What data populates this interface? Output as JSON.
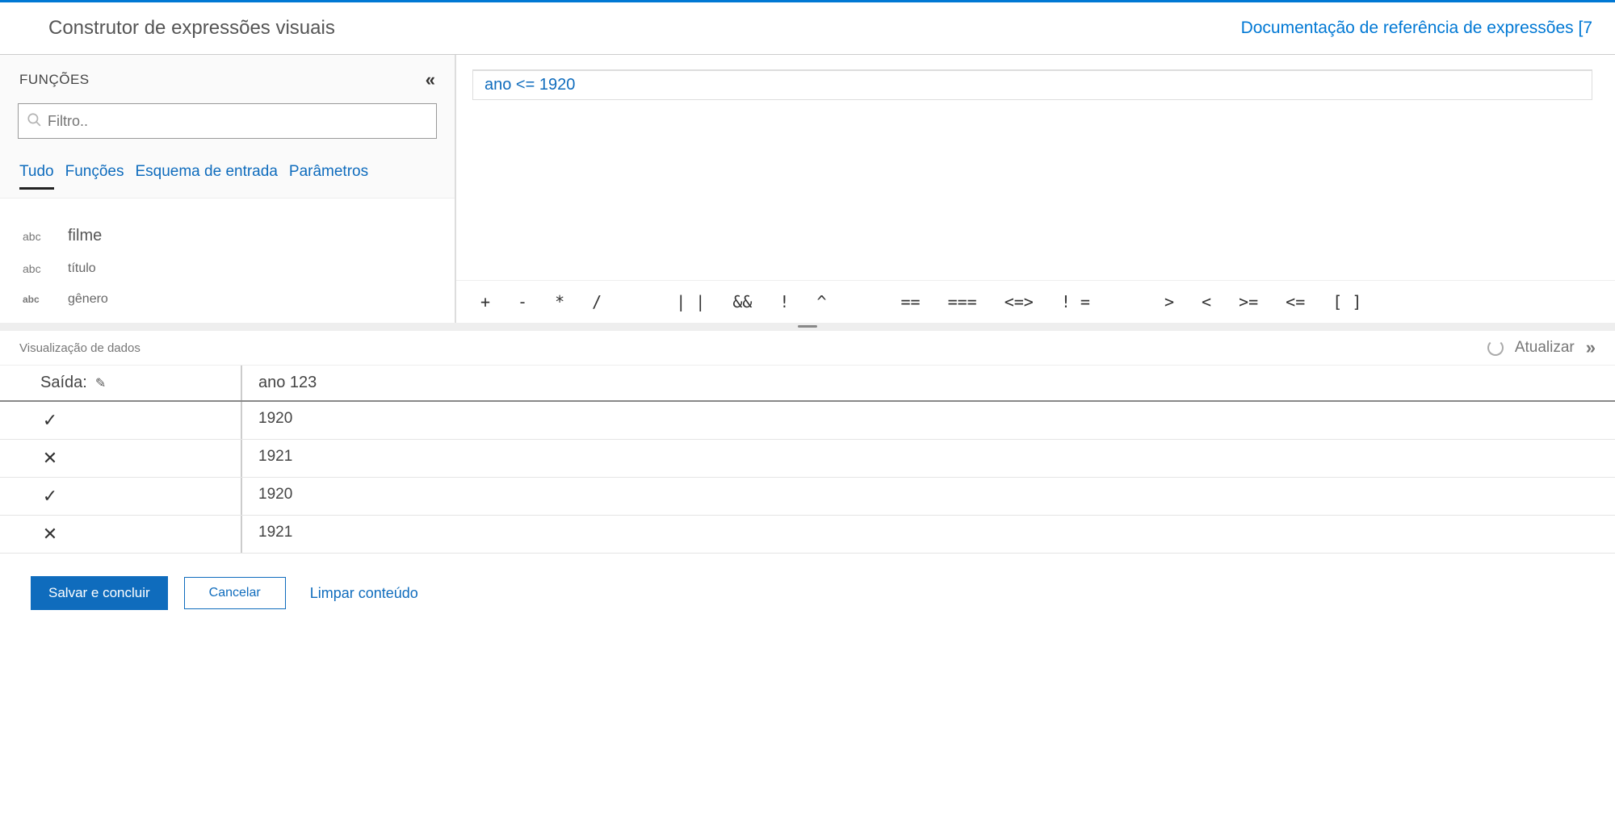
{
  "header": {
    "title": "Construtor de expressões visuais",
    "doc_link": "Documentação de referência de expressões [7"
  },
  "functions": {
    "panel_label": "FUNÇÕES",
    "search_placeholder": "Filtro..",
    "tabs": {
      "all": "Tudo",
      "funcs": "Funções",
      "schema": "Esquema de entrada",
      "params": "Parâmetros"
    },
    "schema_items": [
      {
        "type": "abc",
        "name": "filme"
      },
      {
        "type": "abc",
        "name": "título"
      },
      {
        "type": "abc",
        "name": "gênero"
      }
    ]
  },
  "editor": {
    "expression": "ano <= 1920",
    "operators": [
      "+",
      "-",
      "*",
      "/",
      "| |",
      "&&",
      "!",
      "^",
      "==",
      "===",
      "<=>",
      "! =",
      ">",
      "<",
      ">=",
      "<=",
      "[ ]"
    ]
  },
  "preview": {
    "label": "Visualização de dados",
    "refresh": "Atualizar",
    "output_label": "Saída:",
    "col_header": "ano 123",
    "rows": [
      {
        "match": true,
        "value": "1920"
      },
      {
        "match": false,
        "value": "1921"
      },
      {
        "match": true,
        "value": "1920"
      },
      {
        "match": false,
        "value": "1921"
      }
    ]
  },
  "footer": {
    "save": "Salvar e concluir",
    "cancel": "Cancelar",
    "clear": "Limpar conteúdo"
  }
}
